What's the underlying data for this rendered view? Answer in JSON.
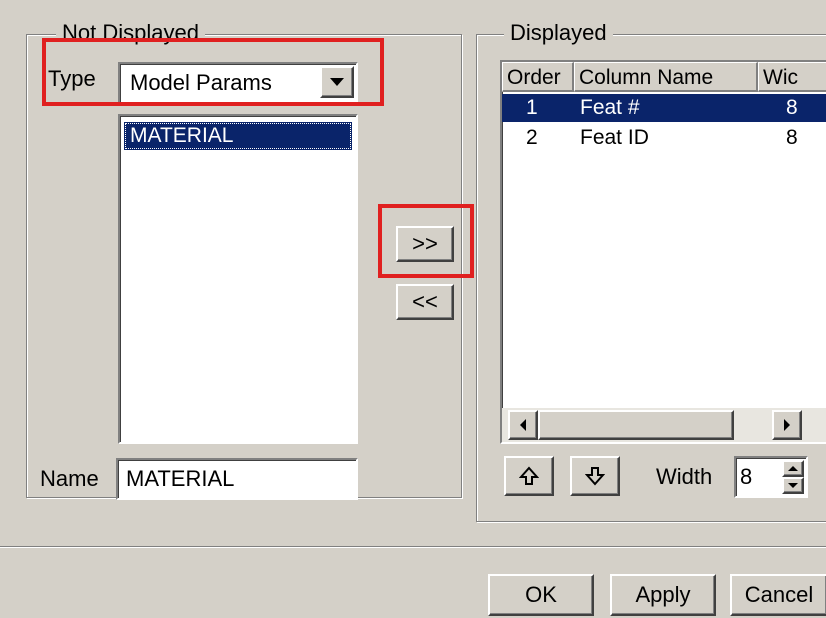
{
  "not_displayed": {
    "legend": "Not Displayed",
    "type_label": "Type",
    "type_value": "Model Params",
    "list_items": [
      "MATERIAL"
    ],
    "name_label": "Name",
    "name_value": "MATERIAL"
  },
  "transfer": {
    "add_label": ">>",
    "remove_label": "<<"
  },
  "displayed": {
    "legend": "Displayed",
    "columns": [
      "Order",
      "Column Name",
      "Wic"
    ],
    "rows": [
      {
        "order": "1",
        "name": "Feat #",
        "width": "8",
        "selected": true
      },
      {
        "order": "2",
        "name": "Feat ID",
        "width": "8",
        "selected": false
      }
    ],
    "width_label": "Width",
    "width_value": "8"
  },
  "footer": {
    "ok_label": "OK",
    "apply_label": "Apply",
    "cancel_label": "Cancel"
  },
  "colors": {
    "highlight": "#e02020",
    "selection": "#0a246a",
    "dialog_bg": "#d4d0c8"
  }
}
